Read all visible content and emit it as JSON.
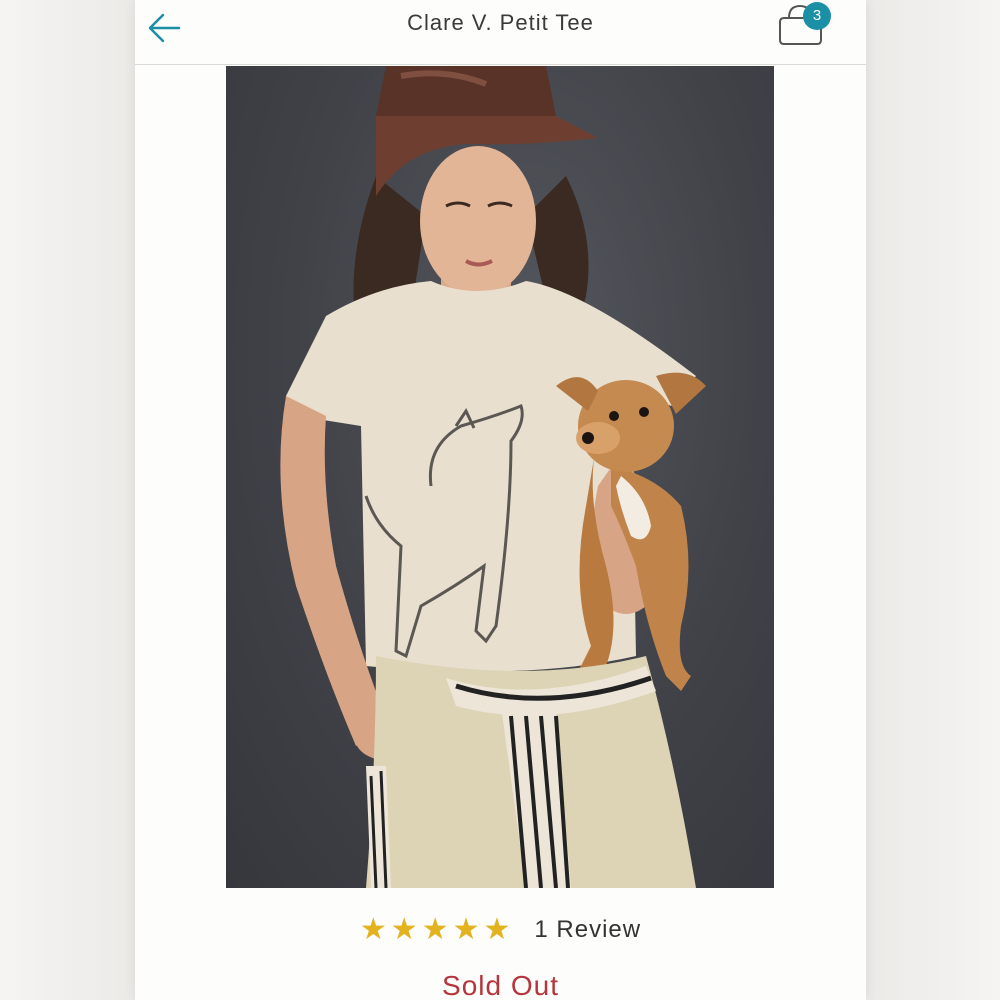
{
  "header": {
    "title": "Clare V. Petit Tee",
    "back_icon": "arrow-left-icon",
    "bag_icon": "shopping-bag-icon",
    "bag_count": "3"
  },
  "product": {
    "image_alt": "Model wearing cream tee with dog line drawing, holding a small dog",
    "rating": {
      "stars": 5,
      "star_glyphs": [
        "★",
        "★",
        "★",
        "★",
        "★"
      ],
      "review_text": "1 Review"
    },
    "status": "Sold Out"
  },
  "colors": {
    "accent": "#1a8fa6",
    "star": "#e3b21f",
    "sold_out": "#b4363c"
  }
}
